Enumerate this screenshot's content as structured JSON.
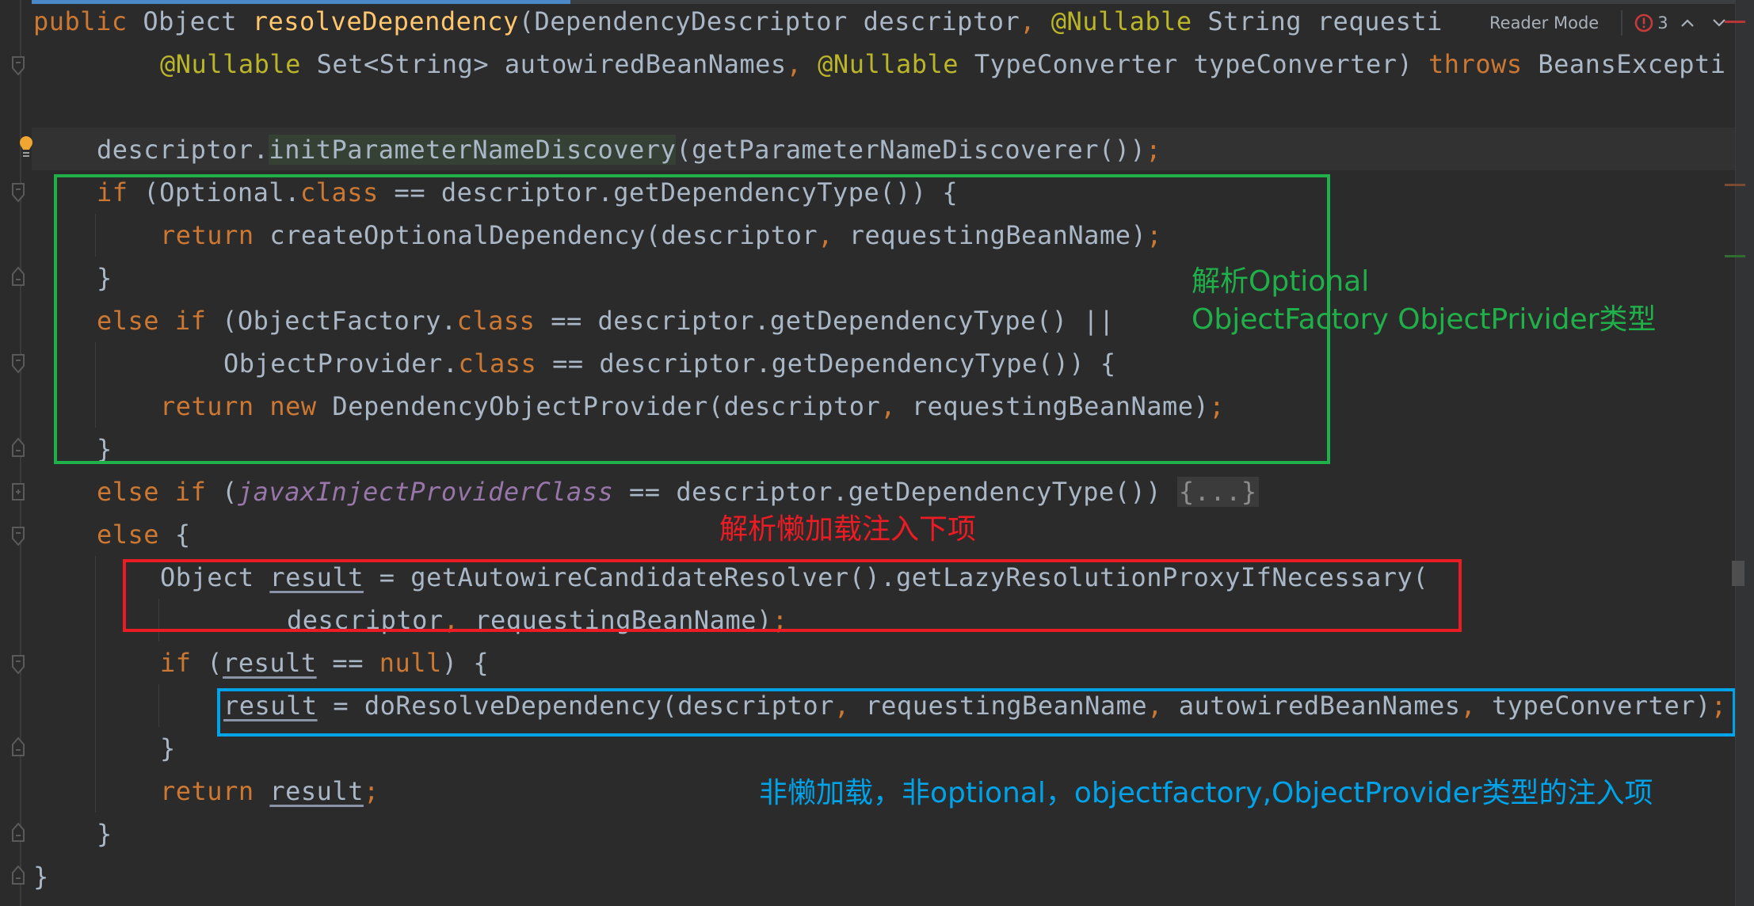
{
  "toolbar": {
    "reader_mode_label": "Reader Mode",
    "error_count": "3",
    "error_icon": "error-circle-icon",
    "prev_icon": "chevron-up-icon",
    "next_icon": "chevron-down-icon"
  },
  "code": {
    "lines": [
      "public Object resolveDependency(DependencyDescriptor descriptor, @Nullable String requesti",
      "        @Nullable Set<String> autowiredBeanNames, @Nullable TypeConverter typeConverter) throws BeansExcepti",
      "",
      "    descriptor.initParameterNameDiscovery(getParameterNameDiscoverer());",
      "    if (Optional.class == descriptor.getDependencyType()) {",
      "        return createOptionalDependency(descriptor, requestingBeanName);",
      "    }",
      "    else if (ObjectFactory.class == descriptor.getDependencyType() ||",
      "            ObjectProvider.class == descriptor.getDependencyType()) {",
      "        return new DependencyObjectProvider(descriptor, requestingBeanName);",
      "    }",
      "    else if (javaxInjectProviderClass == descriptor.getDependencyType()) {...}",
      "    else {",
      "        Object result = getAutowireCandidateResolver().getLazyResolutionProxyIfNecessary(",
      "                descriptor, requestingBeanName);",
      "        if (result == null) {",
      "            result = doResolveDependency(descriptor, requestingBeanName, autowiredBeanNames, typeConverter);",
      "        }",
      "        return result;",
      "    }",
      "}"
    ],
    "tokens": {
      "public": "public",
      "Object": "Object",
      "resolveDependency": "resolveDependency",
      "DependencyDescriptor": "DependencyDescriptor",
      "descriptor": "descriptor",
      "Nullable": "@Nullable",
      "String": "String",
      "requesti": "requesti",
      "SetString": "Set<String>",
      "autowiredBeanNames": "autowiredBeanNames",
      "TypeConverter": "TypeConverter",
      "typeConverter": "typeConverter",
      "throws": "throws",
      "BeansExcepti": "BeansExcepti",
      "initParameterNameDiscovery": "initParameterNameDiscovery",
      "getParameterNameDiscoverer": "getParameterNameDiscoverer",
      "if": "if",
      "else": "else",
      "return": "return",
      "new": "new",
      "class": "class",
      "null": "null",
      "Optional": "Optional",
      "getDependencyType": "getDependencyType",
      "createOptionalDependency": "createOptionalDependency",
      "requestingBeanName": "requestingBeanName",
      "ObjectFactory": "ObjectFactory",
      "ObjectProvider": "ObjectProvider",
      "DependencyObjectProvider": "DependencyObjectProvider",
      "javaxInjectProviderClass": "javaxInjectProviderClass",
      "folded": "{...}",
      "result": "result",
      "getAutowireCandidateResolver": "getAutowireCandidateResolver",
      "getLazyResolutionProxyIfNecessary": "getLazyResolutionProxyIfNecessary",
      "doResolveDependency": "doResolveDependency"
    }
  },
  "annotations": {
    "green_note_line1": "解析Optional",
    "green_note_line2": "ObjectFactory ObjectPrivider类型",
    "red_note": "解析懒加载注入下项",
    "blue_note": "非懒加载，非optional，objectfactory,ObjectProvider类型的注入项",
    "colors": {
      "green": "#20b04a",
      "red": "#ec1c24",
      "blue": "#00a2e8"
    }
  },
  "theme": {
    "background": "#2b2b2b",
    "keyword": "#cc7832",
    "method_decl": "#ffc66d",
    "annotation": "#bbb529",
    "field": "#9876aa",
    "text": "#a9b7c6"
  }
}
